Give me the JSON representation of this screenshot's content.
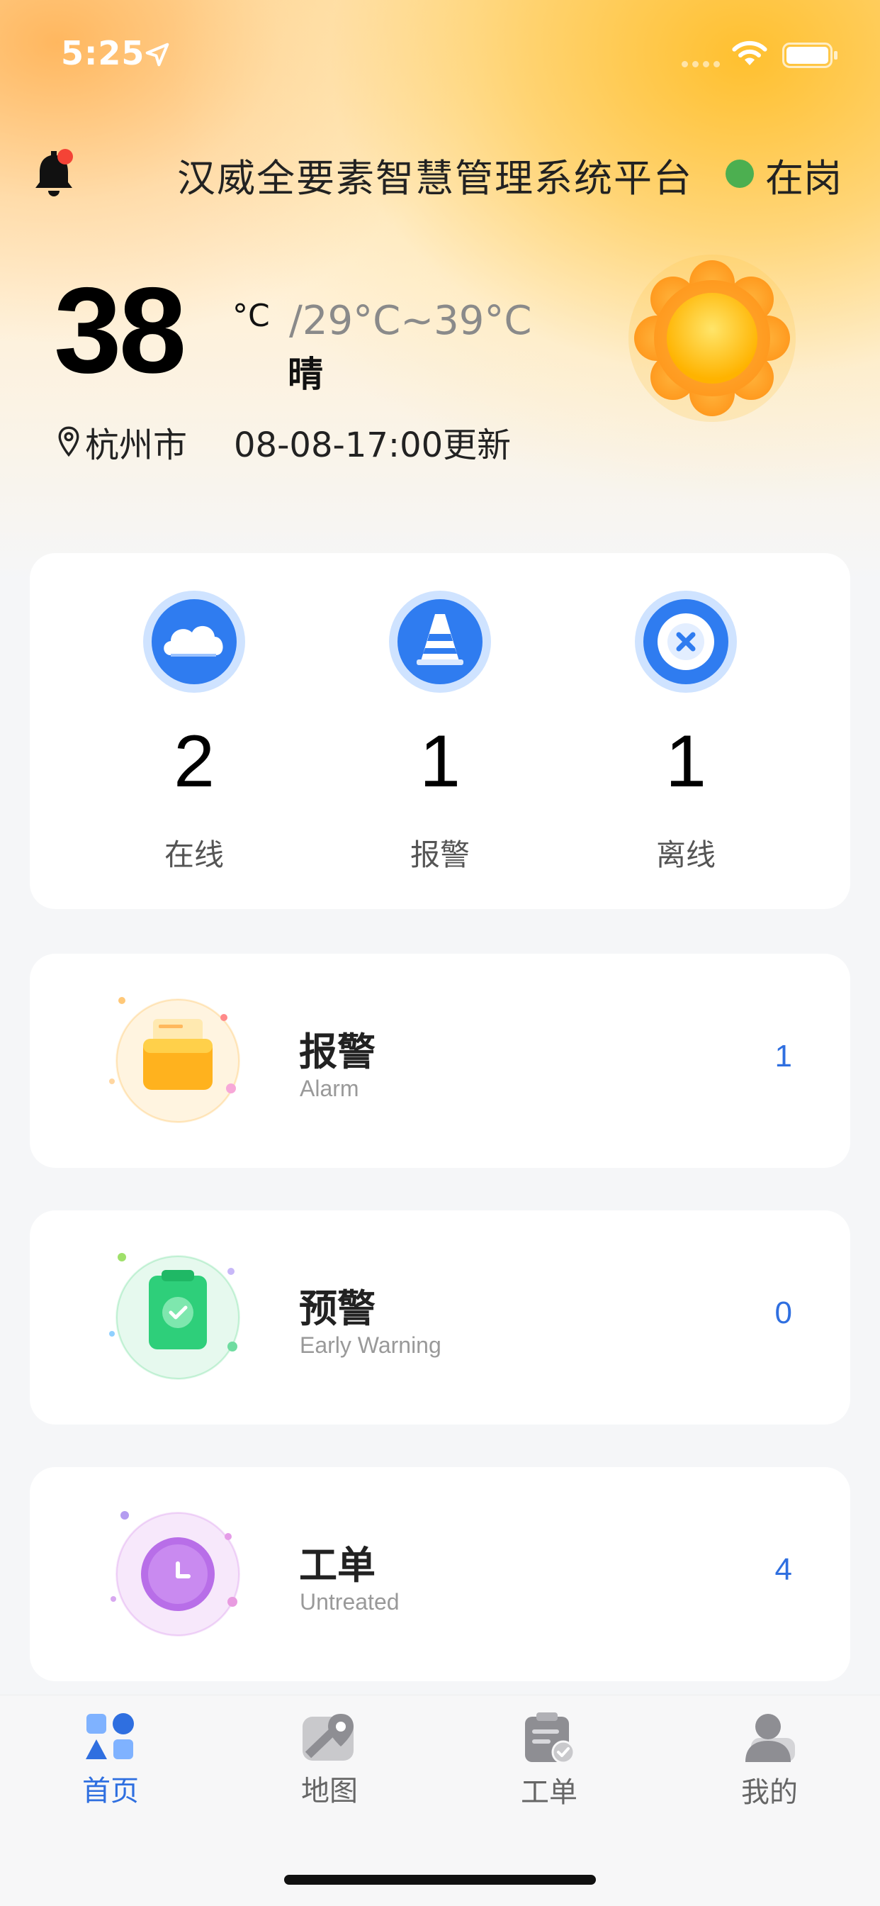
{
  "status_bar": {
    "time": "5:25"
  },
  "header": {
    "title": "汉威全要素智慧管理系统平台",
    "duty_status": "在岗",
    "duty_color": "#4caf50",
    "bell_badge_color": "#f44336"
  },
  "weather": {
    "temperature": "38",
    "unit": "°C",
    "range": "/29°C~39°C",
    "condition": "晴",
    "city": "杭州市",
    "updated": "08-08-17:00更新",
    "icon": "sun-icon"
  },
  "stats": [
    {
      "value": "2",
      "label": "在线",
      "icon": "cloud-icon"
    },
    {
      "value": "1",
      "label": "报警",
      "icon": "traffic-cone-icon"
    },
    {
      "value": "1",
      "label": "离线",
      "icon": "close-circle-icon"
    }
  ],
  "functions": [
    {
      "title": "报警",
      "subtitle": "Alarm",
      "count": "1",
      "icon": "alarm-box-icon"
    },
    {
      "title": "预警",
      "subtitle": "Early Warning",
      "count": "0",
      "icon": "clipboard-check-icon"
    },
    {
      "title": "工单",
      "subtitle": "Untreated",
      "count": "4",
      "icon": "clock-icon"
    }
  ],
  "tabbar": {
    "accent": "#2f6fe0",
    "items": [
      {
        "label": "首页",
        "icon": "home-grid-icon",
        "active": true
      },
      {
        "label": "地图",
        "icon": "map-pin-icon",
        "active": false
      },
      {
        "label": "工单",
        "icon": "work-order-icon",
        "active": false
      },
      {
        "label": "我的",
        "icon": "user-icon",
        "active": false
      }
    ]
  }
}
